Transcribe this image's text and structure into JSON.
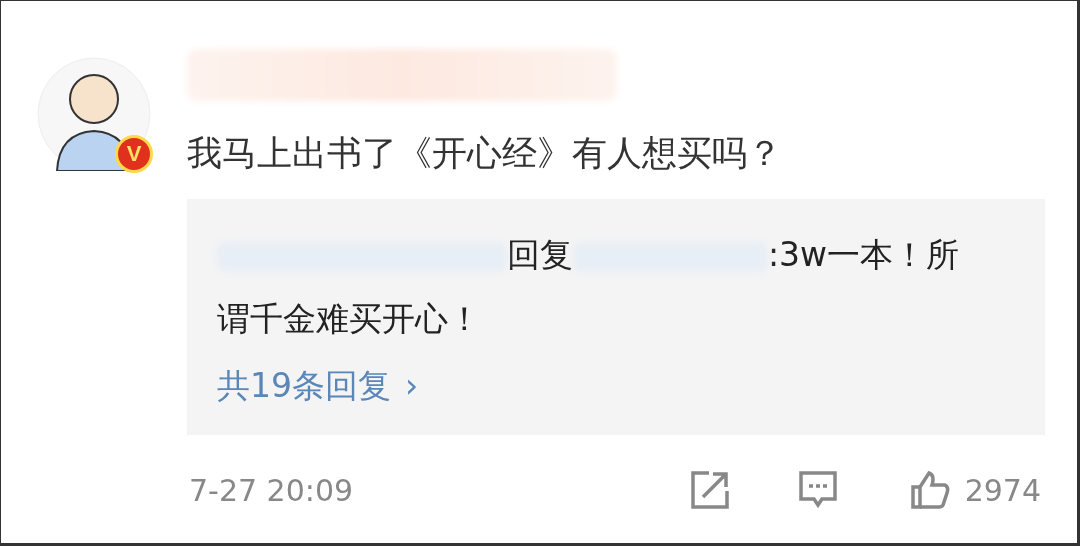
{
  "comment": {
    "verified_badge": "V",
    "text": "我马上出书了《开心经》有人想买吗？",
    "reply_preview": {
      "reply_word": "回复",
      "text_lines": [
        ":3w一本！所",
        "谓千金难买开心！"
      ],
      "more_link": "共19条回复",
      "more_arrow": "›"
    },
    "time": "7-27 20:09",
    "like_count": "2974"
  }
}
